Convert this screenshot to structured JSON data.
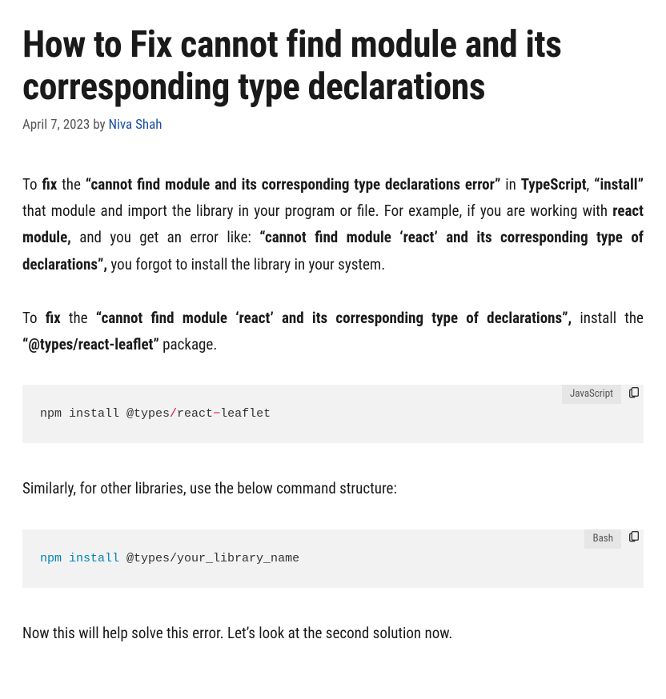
{
  "title": "How to Fix cannot find module and its corresponding type declarations",
  "meta": {
    "date": "April 7, 2023",
    "by": "by",
    "author": "Niva Shah"
  },
  "para1": {
    "t1": "To ",
    "b1": "fix",
    "t2": " the ",
    "b2": "“cannot find module and its corresponding type declarations error”",
    "t3": " in ",
    "b3": "TypeScript",
    "t4": ", ",
    "b4": "“install”",
    "t5": " that module and import the library in your program or file. For example, if you are working with ",
    "b5": "react module,",
    "t6": " and you get an error like: ",
    "b6": "“cannot find module ‘react’ and its corresponding type of declarations”,",
    "t7": " you forgot to install the library in your system."
  },
  "para2": {
    "t1": "To ",
    "b1": "fix",
    "t2": " the ",
    "b2": "“cannot find module ‘react’ and its corresponding type of declarations”,",
    "t3": " install the ",
    "b3": "“@types/react-leaflet”",
    "t4": " package."
  },
  "code1": {
    "lang": "JavaScript",
    "s1": "npm install @types",
    "slash": "/",
    "s2": "react",
    "dash": "−",
    "s3": "leaflet"
  },
  "para3": "Similarly, for other libraries, use the below command structure:",
  "code2": {
    "lang": "Bash",
    "cmd": "npm install",
    "rest": " @types/your_library_name"
  },
  "para4": "Now this will help solve this error. Let’s look at the second solution now."
}
